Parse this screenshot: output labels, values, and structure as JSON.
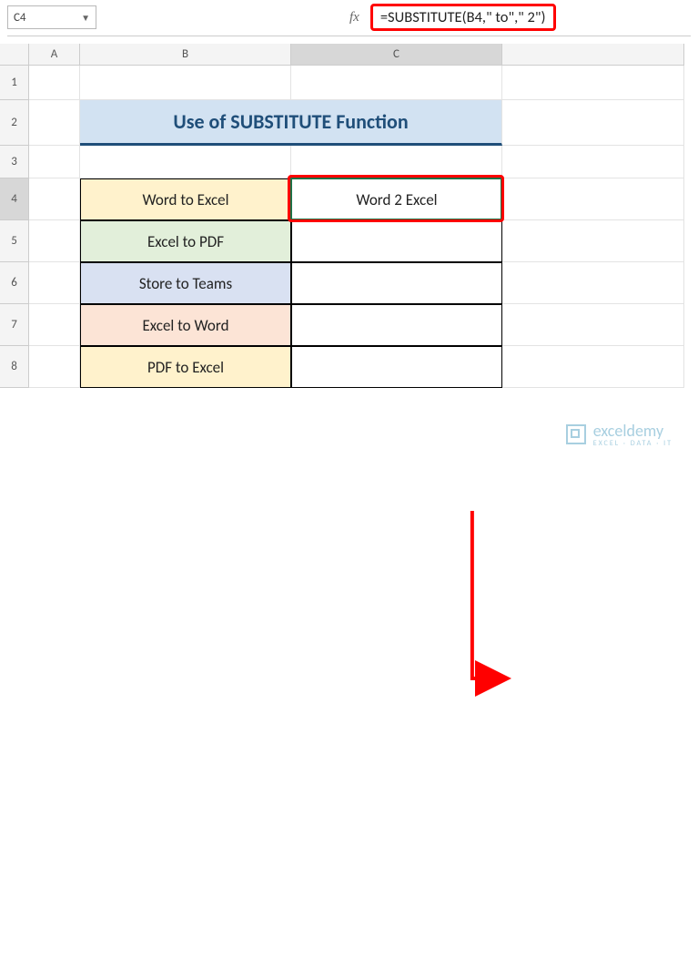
{
  "name_box": "C4",
  "formula_bar": "=SUBSTITUTE(B4,\" to\",\" 2\")",
  "columns": [
    "A",
    "B",
    "C"
  ],
  "rows": [
    "1",
    "2",
    "3",
    "4",
    "5",
    "6",
    "7",
    "8"
  ],
  "title": "Use of SUBSTITUTE Function",
  "table": {
    "b": [
      "Word to Excel",
      "Excel to PDF",
      "Store to Teams",
      "Excel to Word",
      "PDF to Excel"
    ],
    "c": [
      "Word 2 Excel",
      "",
      "",
      "",
      ""
    ]
  },
  "fill_colors": [
    "fill-yellow",
    "fill-green",
    "fill-blue",
    "fill-pink",
    "fill-yellow"
  ],
  "watermark": {
    "brand": "exceldemy",
    "tag": "EXCEL · DATA · IT"
  },
  "chart_data": {
    "type": "table",
    "title": "Use of SUBSTITUTE Function",
    "columns": [
      "B",
      "C"
    ],
    "rows": [
      [
        "Word to Excel",
        "Word 2 Excel"
      ],
      [
        "Excel to PDF",
        ""
      ],
      [
        "Store to Teams",
        ""
      ],
      [
        "Excel to Word",
        ""
      ],
      [
        "PDF to Excel",
        ""
      ]
    ],
    "formula_in_C4": "=SUBSTITUTE(B4,\" to\",\" 2\")"
  }
}
